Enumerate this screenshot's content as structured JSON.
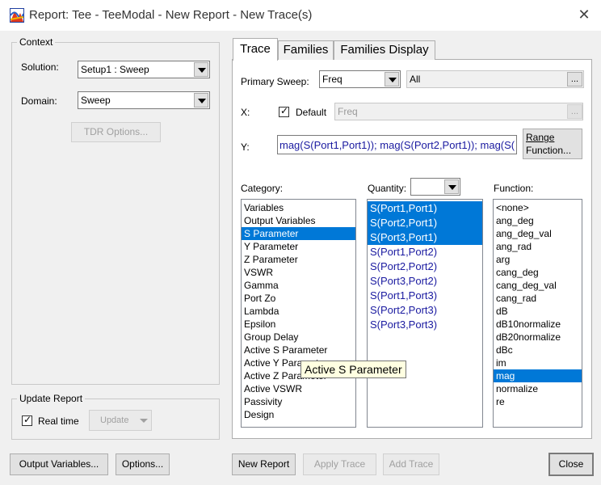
{
  "window": {
    "title": "Report: Tee - TeeModal - New Report - New Trace(s)",
    "close_icon": "close-icon"
  },
  "context": {
    "group_label": "Context",
    "solution_label": "Solution:",
    "solution_value": "Setup1 : Sweep",
    "domain_label": "Domain:",
    "domain_value": "Sweep",
    "tdr_button": "TDR Options..."
  },
  "update_report": {
    "group_label": "Update Report",
    "realtime_label": "Real time",
    "realtime_checked": true,
    "update_button": "Update"
  },
  "tabs": [
    {
      "label": "Trace",
      "active": true
    },
    {
      "label": "Families",
      "active": false
    },
    {
      "label": "Families Display",
      "active": false
    }
  ],
  "trace": {
    "primary_sweep_label": "Primary Sweep:",
    "primary_sweep_value": "Freq",
    "primary_sweep_range": "All",
    "ellipsis": "...",
    "x_label": "X:",
    "default_label": "Default",
    "default_checked": true,
    "x_value": "Freq",
    "y_label": "Y:",
    "y_value": "mag(S(Port1,Port1)); mag(S(Port2,Port1)); mag(S(",
    "range_button_line1": "Range",
    "range_button_line2": "Function...",
    "category_label": "Category:",
    "quantity_label": "Quantity:",
    "quantity_filter": "",
    "function_label": "Function:",
    "categories": [
      {
        "label": "Variables",
        "selected": false
      },
      {
        "label": "Output Variables",
        "selected": false
      },
      {
        "label": "S Parameter",
        "selected": true
      },
      {
        "label": "Y Parameter",
        "selected": false
      },
      {
        "label": "Z Parameter",
        "selected": false
      },
      {
        "label": "VSWR",
        "selected": false
      },
      {
        "label": "Gamma",
        "selected": false
      },
      {
        "label": "Port Zo",
        "selected": false
      },
      {
        "label": "Lambda",
        "selected": false
      },
      {
        "label": "Epsilon",
        "selected": false
      },
      {
        "label": "Group Delay",
        "selected": false
      },
      {
        "label": "Active S Parameter",
        "selected": false
      },
      {
        "label": "Active Y Parameter",
        "selected": false
      },
      {
        "label": "Active Z Parameter",
        "selected": false
      },
      {
        "label": "Active VSWR",
        "selected": false
      },
      {
        "label": "Passivity",
        "selected": false
      },
      {
        "label": "Design",
        "selected": false
      }
    ],
    "quantities": [
      {
        "label": "S(Port1,Port1)",
        "selected": true
      },
      {
        "label": "S(Port2,Port1)",
        "selected": true
      },
      {
        "label": "S(Port3,Port1)",
        "selected": true
      },
      {
        "label": "S(Port1,Port2)",
        "selected": false
      },
      {
        "label": "S(Port2,Port2)",
        "selected": false
      },
      {
        "label": "S(Port3,Port2)",
        "selected": false
      },
      {
        "label": "S(Port1,Port3)",
        "selected": false
      },
      {
        "label": "S(Port2,Port3)",
        "selected": false
      },
      {
        "label": "S(Port3,Port3)",
        "selected": false
      }
    ],
    "functions": [
      {
        "label": "<none>",
        "selected": false
      },
      {
        "label": "ang_deg",
        "selected": false
      },
      {
        "label": "ang_deg_val",
        "selected": false
      },
      {
        "label": "ang_rad",
        "selected": false
      },
      {
        "label": "arg",
        "selected": false
      },
      {
        "label": "cang_deg",
        "selected": false
      },
      {
        "label": "cang_deg_val",
        "selected": false
      },
      {
        "label": "cang_rad",
        "selected": false
      },
      {
        "label": "dB",
        "selected": false
      },
      {
        "label": "dB10normalize",
        "selected": false
      },
      {
        "label": "dB20normalize",
        "selected": false
      },
      {
        "label": "dBc",
        "selected": false
      },
      {
        "label": "im",
        "selected": false
      },
      {
        "label": "mag",
        "selected": true
      },
      {
        "label": "normalize",
        "selected": false
      },
      {
        "label": "re",
        "selected": false
      }
    ],
    "tooltip": "Active S Parameter"
  },
  "footer": {
    "output_variables": "Output Variables...",
    "options": "Options...",
    "new_report": "New Report",
    "apply_trace": "Apply Trace",
    "add_trace": "Add Trace",
    "close": "Close"
  }
}
